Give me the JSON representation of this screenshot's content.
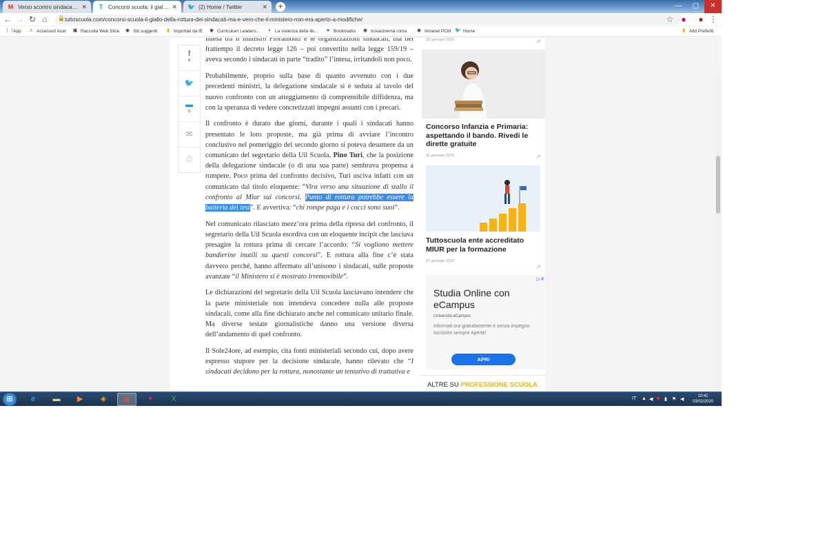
{
  "tabs": [
    {
      "label": "Verso scontro sindacati-minister",
      "icon": "gmail-icon"
    },
    {
      "label": "Concorsi scuola: il giallo della rot",
      "icon": "tuttoscuola-icon"
    },
    {
      "label": "(2) Home / Twitter",
      "icon": "twitter-icon"
    }
  ],
  "window": {
    "minimize": "—",
    "maximize": "▢",
    "close": "✕"
  },
  "url": "tuttoscuola.com/concorsi-scuola-il-giallo-della-rottura-dei-sindacati-ma-e-vero-che-il-ministero-non-era-aperto-a-modifiche/",
  "bookmarks": [
    "App",
    "Accessori Acer",
    "Raccolta Web Slice",
    "Siti suggeriti",
    "Importati da IE",
    "Curriculum Leaders...",
    "La violenza della lib...",
    "Bookmarks",
    "trovacinema roma",
    "Intranet PCM",
    "Home"
  ],
  "other_bookmarks": "Altri Preferiti",
  "share": {
    "facebook_count": "0",
    "comment_count": "0"
  },
  "article": {
    "p1": "intesa tra il ministro Fioramonti e le organizzazioni sindacali, ma nel frattempo il decreto legge 126 – poi convertito nella legge 159/19 – aveva secondo i sindacati in parte “tradito” l’intesa, irritandoli non poco.",
    "p2": "Probabilmente, proprio sulla base di quanto avvenuto con i due precedenti ministri, la delegazione sindacale si è seduta al tavolo del nuovo confronto con un atteggiamento di comprensibile diffidenza, ma con la speranza di vedere concretizzati impegni assunti con i precari.",
    "p3a": "Il confronto è durato due giorni, durante i quali i sindacati hanno presentato le loro proposte, ma già prima di avviare l’incontro conclusivo nel pomeriggio del secondo giorno si poteva desumere da un comunicato del segretario della Uil Scuola, ",
    "p3_name": "Pino Turi",
    "p3b": ", che la posizione della delegazione sindacale (o di una sua parte) sembrava propensa a rompere. Poco prima del confronto decisivo, Turi usciva infatti con un comunicato dal titolo eloquente: “",
    "p3_quote": "Vira verso una situazione di stallo il confronto al Miur sui concorsi.",
    "p3_highlight": "Punto di rottura potrebbe essere la batteria dei test",
    "p3c": "”. E avvertiva: “",
    "p3_quote2": "chi rompe paga e i cocci sono suoi",
    "p3d": "”.",
    "p4a": "Nel comunicato rilasciato mezz’ora prima della ripresa del confronto, il segretario della Uil Scuola esordiva con un eloquente incipit che lasciava presagire la rottura prima di cercare l’accordo: “",
    "p4_quote": "Si vogliono mettere bandierine inutili su questi concorsi",
    "p4b": "”. E rottura alla fine c’è stata davvero perché, hanno affermato all’unisono i sindacati, sulle proposte avanzate “",
    "p4_quote2": "il Ministero si è mostrato irremovibile",
    "p4c": "”.",
    "p5": "Le dichiarazioni del segretario della Uil Scuola lasciavano intendere che la parte ministeriale non intendeva concedere nulla alle proposte sindacali, come alla fine dichiarato anche nel comunicato unitario finale. Ma diverse testate giornalistiche danno una versione diversa dell’andamento di quel confronto.",
    "p6a": "Il Sole24ore, ad esempio, cita fonti ministeriali secondo cui, dopo avere espresso stupore per la decisione sindacale, hanno rilevato che “",
    "p6_quote": "I sindacati decidono per la rottura, nonostante un tentativo di trattativa e"
  },
  "sidebar": {
    "card0_date": "22 gennaio 2020",
    "card1": {
      "title": "Concorso Infanzia e Primaria: aspettando il bando. Rivedi le dirette gratuite",
      "date": "31 gennaio 2020"
    },
    "card2": {
      "title": "Tuttoscuola ente accreditato MIUR per la formazione",
      "date": "07 gennaio 2020"
    },
    "ad": {
      "title": "Studia Online con eCampus",
      "sponsor": "Università eCampus",
      "text": "Informati ora gratuitamente e senza impegno. Iscrizioni sempre Aperte!",
      "button": "APRI"
    },
    "altre_prefix": "ALTRE SU ",
    "altre_accent": "PROFESSIONE SCUOLA"
  },
  "taskbar": {
    "lang": "IT",
    "time": "10:41",
    "date": "03/02/2020"
  },
  "colors": {
    "accent": "#f2b400",
    "highlight": "#3b8df0",
    "twitter": "#1da1f2",
    "facebook": "#3b5998"
  }
}
